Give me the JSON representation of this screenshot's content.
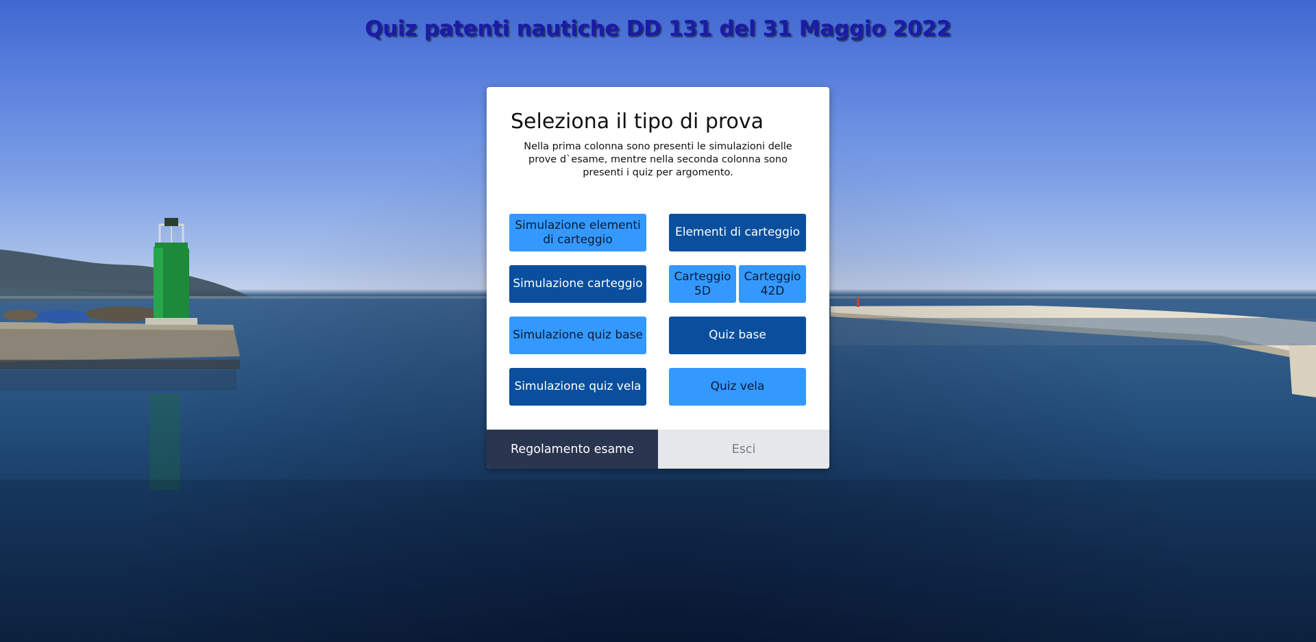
{
  "page": {
    "title": "Quiz patenti nautiche DD 131 del 31 Maggio 2022"
  },
  "dialog": {
    "heading": "Seleziona il tipo di prova",
    "description": "Nella prima colonna sono presenti le simulazioni delle prove d`esame, mentre nella seconda colonna sono presenti i quiz per argomento.",
    "left_column": [
      "Simulazione elementi di carteggio",
      "Simulazione carteggio",
      "Simulazione quiz base",
      "Simulazione quiz vela"
    ],
    "right_column": {
      "elementi": "Elementi di carteggio",
      "carteggio_5d": "Carteggio 5D",
      "carteggio_42d": "Carteggio 42D",
      "quiz_base": "Quiz base",
      "quiz_vela": "Quiz vela"
    },
    "footer": {
      "regolamento": "Regolamento esame",
      "esci": "Esci"
    }
  },
  "colors": {
    "light_button": "#3399ff",
    "dark_button": "#0a4f9e",
    "footer_dark": "#2a3550",
    "footer_light": "#e6e7ea",
    "title_color": "#1b1ba8"
  }
}
